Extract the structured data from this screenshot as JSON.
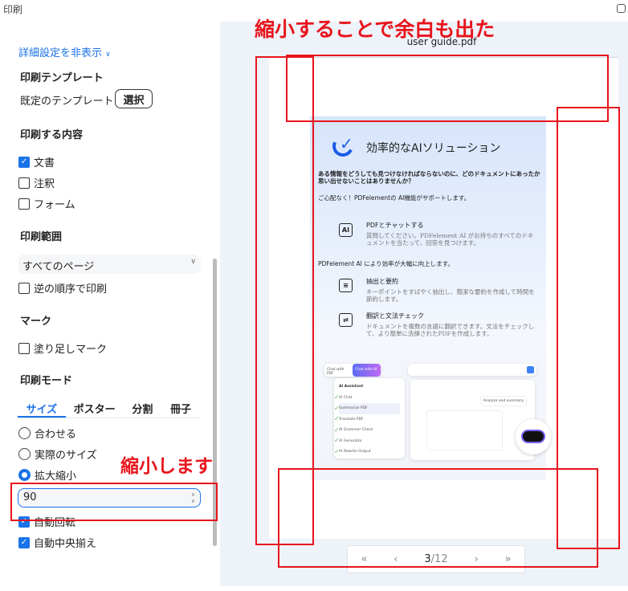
{
  "window": {
    "title": "印刷"
  },
  "sidebar": {
    "toggle_label": "詳細設定を非表示",
    "template": {
      "heading": "印刷テンプレート",
      "label": "既定のテンプレート",
      "button": "選択"
    },
    "content": {
      "heading": "印刷する内容",
      "items": [
        {
          "label": "文書",
          "checked": true
        },
        {
          "label": "注釈",
          "checked": false
        },
        {
          "label": "フォーム",
          "checked": false
        }
      ]
    },
    "range": {
      "heading": "印刷範囲",
      "selected": "すべてのページ",
      "reverse_label": "逆の順序で印刷",
      "reverse_checked": false
    },
    "marks": {
      "heading": "マーク",
      "bleed_label": "塗り足しマーク",
      "bleed_checked": false
    },
    "mode": {
      "heading": "印刷モード",
      "tabs": [
        "サイズ",
        "ポスター",
        "分割",
        "冊子"
      ],
      "active_tab": "サイズ",
      "options": [
        {
          "label": "合わせる",
          "selected": false
        },
        {
          "label": "実際のサイズ",
          "selected": false
        },
        {
          "label": "拡大縮小",
          "selected": true
        }
      ],
      "scale_value": "90",
      "auto_rotate": {
        "label": "自動回転",
        "checked": true
      },
      "auto_center": {
        "label": "自動中央揃え",
        "checked": true
      }
    }
  },
  "preview": {
    "filename": "user guide.pdf",
    "page_content": {
      "title": "効率的なAIソリューション",
      "intro": "ある情報をどうしても見つけなければならないのに、どのドキュメントにあったか思い出せないことはありませんか？",
      "intro2": "ご心配なく！PDFelementの AI機能がサポートします。",
      "f1_title": "PDFとチャットする",
      "f1_text": "質問してください。PDFelement AI がお持ちのすべてのドキュメントを当たって、回答を見つけます。",
      "mid": "PDFelement AI により効率が大幅に向上します。",
      "f2_title": "抽出と要約",
      "f2_text": "キーポイントをすばやく抽出し、簡潔な要約を作成して時間を節約します。",
      "f3_title": "翻訳と文法チェック",
      "f3_text": "ドキュメントを複数の言語に翻訳できます。文法をチェックして、より簡単に洗練されたPDFを作成します。",
      "mock": {
        "tab1": "Chat with PDF",
        "tab2": "Chat with AI",
        "assistant": "AI Assistant",
        "menu": [
          "AI Chat",
          "Summarize PDF",
          "Translate PDF",
          "AI Grammar Check",
          "AI Generator",
          "AI Rewrite Output"
        ],
        "request": "Analyze and summary"
      }
    },
    "pager": {
      "current": "3",
      "total": "/12"
    }
  },
  "annotations": {
    "top": "縮小することで余白も出た",
    "left": "縮小します"
  },
  "colors": {
    "accent": "#1a73e8",
    "annotation": "#e8141c"
  }
}
